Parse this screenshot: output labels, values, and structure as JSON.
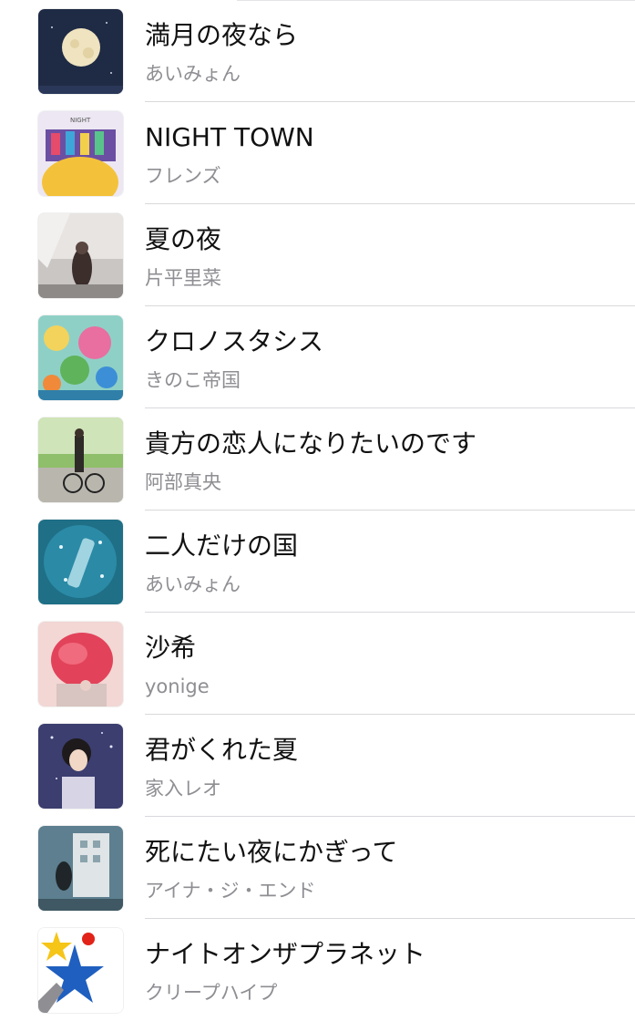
{
  "tracks": [
    {
      "title": "満月の夜なら",
      "artist": "あいみょん"
    },
    {
      "title": "NIGHT TOWN",
      "artist": "フレンズ"
    },
    {
      "title": "夏の夜",
      "artist": "片平里菜"
    },
    {
      "title": "クロノスタシス",
      "artist": "きのこ帝国"
    },
    {
      "title": "貴方の恋人になりたいのです",
      "artist": "阿部真央"
    },
    {
      "title": "二人だけの国",
      "artist": "あいみょん"
    },
    {
      "title": "沙希",
      "artist": "yonige"
    },
    {
      "title": "君がくれた夏",
      "artist": "家入レオ"
    },
    {
      "title": "死にたい夜にかぎって",
      "artist": "アイナ・ジ・エンド"
    },
    {
      "title": "ナイトオンザプラネット",
      "artist": "クリープハイプ"
    }
  ]
}
